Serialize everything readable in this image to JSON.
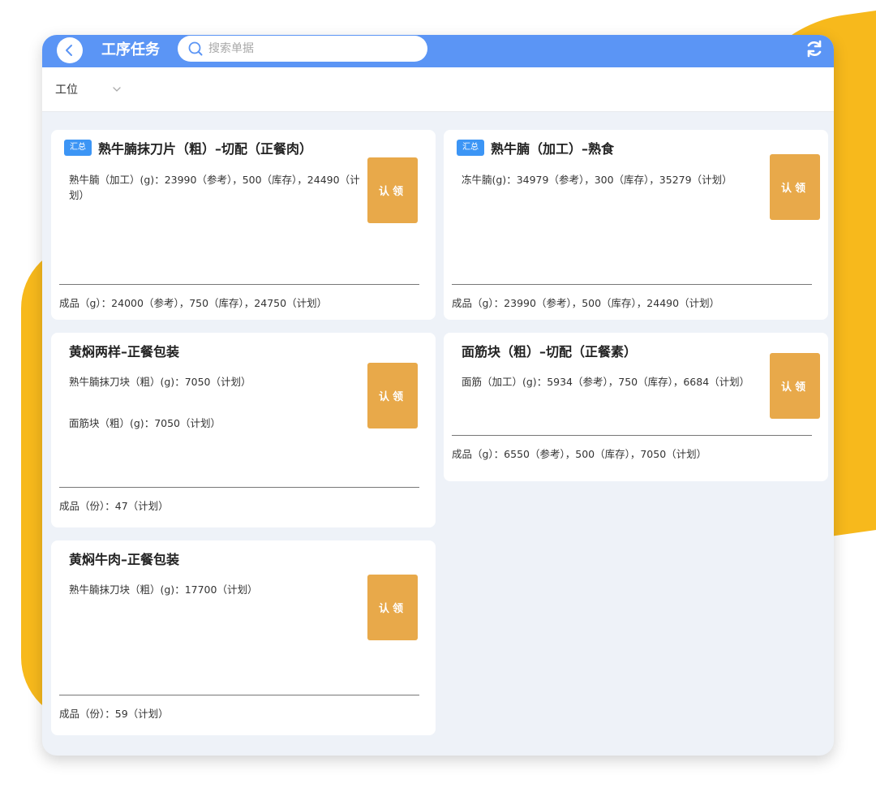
{
  "header": {
    "title": "工序任务",
    "search_placeholder": "搜索单据"
  },
  "filter": {
    "label": "工位"
  },
  "cards": [
    {
      "badge": "汇总",
      "title": "熟牛腩抹刀片（粗）–切配（正餐肉）",
      "lines": [
        "熟牛腩（加工）(g)：23990（参考），500（库存），24490（计划）"
      ],
      "button": "认领",
      "footer": "成品（g）：24000（参考），750（库存），24750（计划）"
    },
    {
      "badge": "汇总",
      "title": "熟牛腩（加工）–熟食",
      "lines": [
        "冻牛腩(g)：34979（参考），300（库存），35279（计划）"
      ],
      "button": "认领",
      "footer": "成品（g）：23990（参考），500（库存），24490（计划）"
    },
    {
      "badge": "",
      "title": "黄焖两样–正餐包装",
      "lines": [
        "熟牛腩抹刀块（粗）(g)：7050（计划）",
        "面筋块（粗）(g)：7050（计划）"
      ],
      "button": "认领",
      "footer": "成品（份）：47（计划）"
    },
    {
      "badge": "",
      "title": "面筋块（粗）–切配（正餐素）",
      "lines": [
        "面筋（加工）(g)：5934（参考），750（库存），6684（计划）"
      ],
      "button": "认领",
      "footer": "成品（g）：6550（参考），500（库存），7050（计划）"
    },
    {
      "badge": "",
      "title": "黄焖牛肉–正餐包装",
      "lines": [
        "熟牛腩抹刀块（粗）(g)：17700（计划）"
      ],
      "button": "认领",
      "footer": "成品（份）：59（计划）"
    }
  ],
  "colors": {
    "topbar": "#5B95F5",
    "badge": "#3C95F5",
    "claim_button": "#E8A94A",
    "accent_yellow": "#F7B91C"
  }
}
